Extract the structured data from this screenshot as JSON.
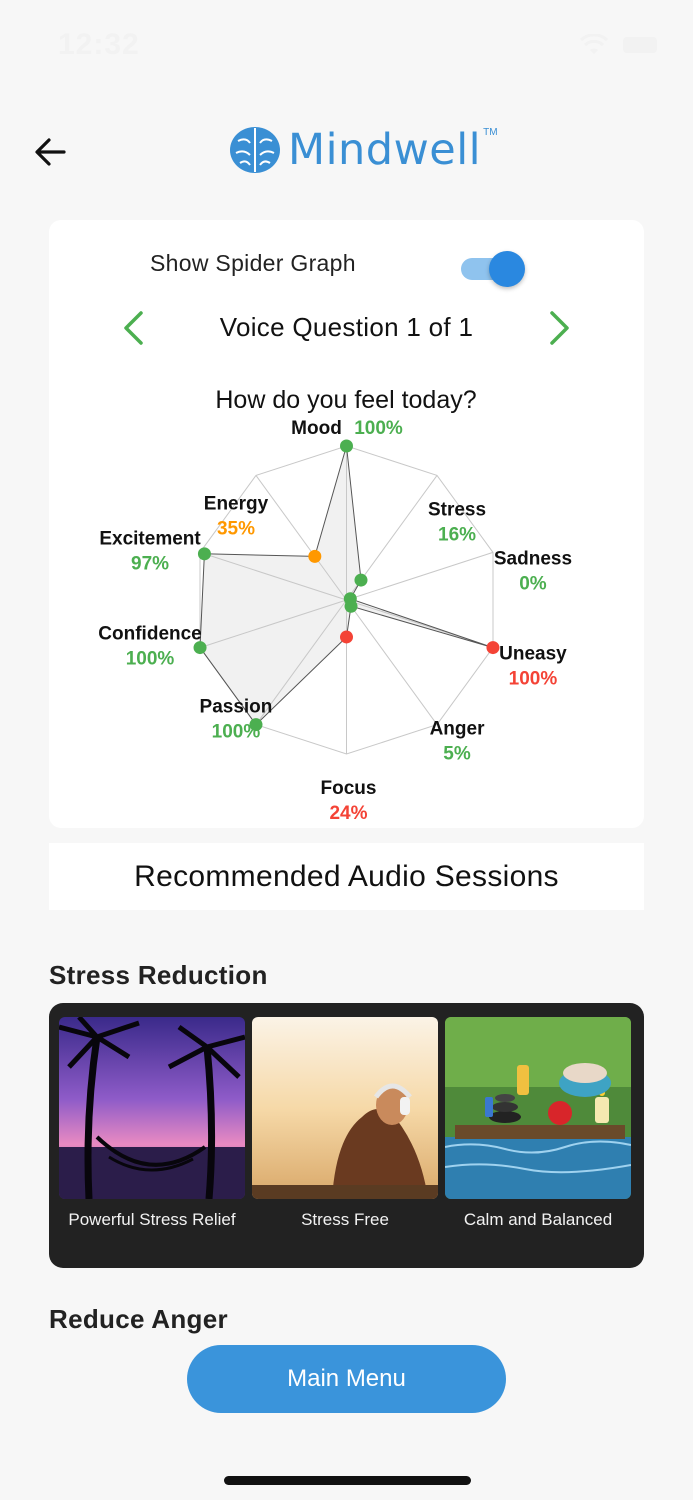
{
  "status_bar": {
    "time": "12:32"
  },
  "header": {
    "logo_text": "Mindwell",
    "logo_tm": "TM"
  },
  "spider_card": {
    "toggle_label": "Show Spider Graph",
    "toggle_on": true,
    "question_label": "Voice Question 1 of 1"
  },
  "chart_data": {
    "type": "radar",
    "title": "How do you feel today?",
    "axes": [
      {
        "label": "Mood",
        "value": 100,
        "display": "100%",
        "color": "#4caf50"
      },
      {
        "label": "Stress",
        "value": 16,
        "display": "16%",
        "color": "#4caf50"
      },
      {
        "label": "Sadness",
        "value": 0,
        "display": "0%",
        "color": "#4caf50"
      },
      {
        "label": "Uneasy",
        "value": 100,
        "display": "100%",
        "color": "#f44336"
      },
      {
        "label": "Anger",
        "value": 5,
        "display": "5%",
        "color": "#4caf50"
      },
      {
        "label": "Focus",
        "value": 24,
        "display": "24%",
        "color": "#f44336"
      },
      {
        "label": "Passion",
        "value": 100,
        "display": "100%",
        "color": "#4caf50"
      },
      {
        "label": "Confidence",
        "value": 100,
        "display": "100%",
        "color": "#4caf50"
      },
      {
        "label": "Excitement",
        "value": 97,
        "display": "97%",
        "color": "#4caf50"
      },
      {
        "label": "Energy",
        "value": 35,
        "display": "35%",
        "color": "#ff9800"
      }
    ],
    "range": [
      0,
      100
    ],
    "grid": true
  },
  "recommended": {
    "title": "Recommended Audio Sessions"
  },
  "sections": [
    {
      "title": "Stress Reduction",
      "sessions": [
        {
          "label": "Powerful Stress Relief"
        },
        {
          "label": "Stress Free"
        },
        {
          "label": "Calm and Balanced"
        }
      ]
    },
    {
      "title": "Reduce Anger"
    }
  ],
  "main_menu": {
    "label": "Main Menu"
  }
}
